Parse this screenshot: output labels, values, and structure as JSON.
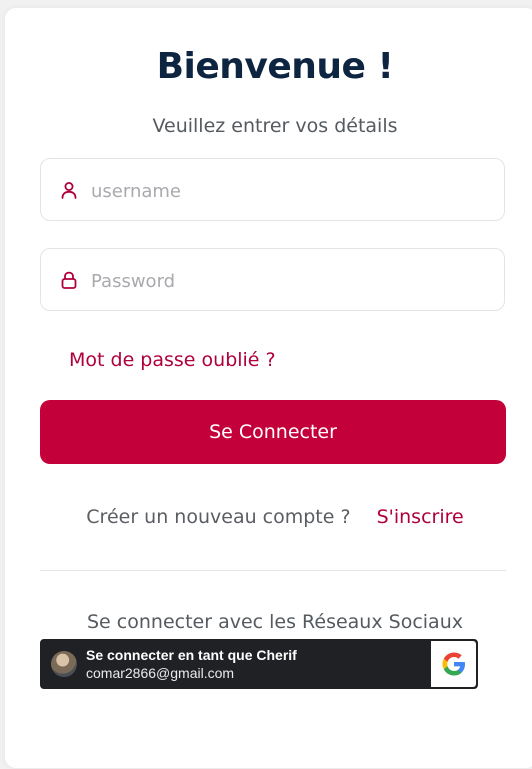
{
  "login": {
    "title": "Bienvenue !",
    "subtitle": "Veuillez entrer vos détails",
    "username_placeholder": "username",
    "password_placeholder": "Password",
    "forgot_password": "Mot de passe oublié ?",
    "login_button": "Se Connecter",
    "register_question": "Créer un nouveau compte ?",
    "register_link": "S'inscrire",
    "social_label": "Se connecter avec les Réseaux Sociaux"
  },
  "google_button": {
    "line1": "Se connecter en tant que Cherif",
    "line2": "comar2866@gmail.com",
    "icon": "google-g-icon"
  },
  "colors": {
    "accent": "#c3003a",
    "title": "#0d2540",
    "google_bg": "#202124"
  },
  "icons": {
    "username": "user-icon",
    "password": "lock-icon",
    "avatar": "avatar"
  }
}
